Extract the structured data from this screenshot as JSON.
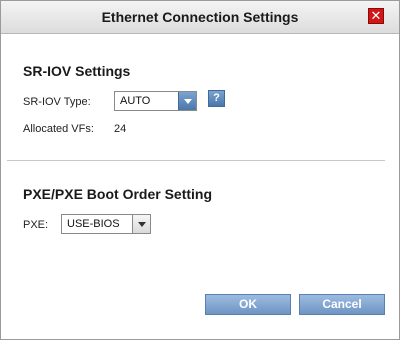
{
  "dialog": {
    "title": "Ethernet Connection Settings",
    "close_glyph": "✕"
  },
  "sriov": {
    "heading": "SR-IOV Settings",
    "type_label": "SR-IOV Type:",
    "type_value": "AUTO",
    "help_glyph": "?",
    "allocated_label": "Allocated VFs:",
    "allocated_value": "24"
  },
  "pxe": {
    "heading": "PXE/PXE Boot Order Setting",
    "label": "PXE:",
    "value": "USE-BIOS"
  },
  "buttons": {
    "ok": "OK",
    "cancel": "Cancel"
  },
  "colors": {
    "accent_blue": "#6f95c4",
    "close_red": "#d01616"
  },
  "icons": {
    "close": "close-icon",
    "help": "help-icon",
    "dropdown": "chevron-down-icon"
  }
}
